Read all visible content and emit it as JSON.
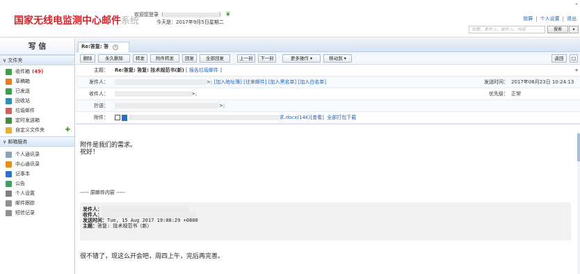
{
  "header": {
    "logo_main": "国家无线电监测中心邮件",
    "logo_sys": "系统",
    "welcome_line": "欢迎您登录（",
    "welcome_tail": "）",
    "date_line": "今天是：2017年9月5日星期二",
    "links": [
      "锁屏",
      "个人设置",
      "退出"
    ],
    "search_placeholder": "主题、发件人、收件人、内容",
    "search_button": "搜索",
    "search_dd": "▾",
    "collapse": "⌃"
  },
  "sidebar": {
    "compose": "写 信",
    "folders_title": "文件夹",
    "folders": [
      {
        "label": "收件箱",
        "count": "(49)",
        "icon": "inbox-icon",
        "color": "#3aa04a"
      },
      {
        "label": "草稿箱",
        "icon": "draft-icon",
        "color": "#e08020"
      },
      {
        "label": "已发送",
        "icon": "sent-icon",
        "color": "#3aa04a"
      },
      {
        "label": "回收站",
        "icon": "recycle-icon",
        "color": "#2a90c0"
      },
      {
        "label": "垃圾邮件",
        "icon": "spam-icon",
        "color": "#d06060"
      },
      {
        "label": "定时发送箱",
        "icon": "timer-icon",
        "color": "#4a8a3a"
      },
      {
        "label": "自定义文件夹",
        "icon": "folder-icon",
        "color": "#e8b030"
      }
    ],
    "services_title": "邮箱服务",
    "services": [
      {
        "label": "个人通讯录",
        "icon": "contacts-icon",
        "color": "#8aa0b8"
      },
      {
        "label": "中心通讯录",
        "icon": "org-contacts-icon",
        "color": "#e09020"
      },
      {
        "label": "记事本",
        "icon": "notepad-icon",
        "color": "#3070c0"
      },
      {
        "label": "公告",
        "icon": "notice-icon",
        "color": "#40a060"
      },
      {
        "label": "个人设置",
        "icon": "settings-icon",
        "color": "#808080"
      },
      {
        "label": "邮件跟踪",
        "icon": "track-icon",
        "color": "#909090"
      },
      {
        "label": "短信记录",
        "icon": "sms-icon",
        "color": "#909090"
      }
    ]
  },
  "tab": {
    "label": "Re:答复: 答",
    "close": "×"
  },
  "toolbar": {
    "buttons": [
      "删除",
      "永久删除",
      "转发",
      "附件转发",
      "回复",
      "全部回复",
      "上一封",
      "下一封",
      "更多操作 ▾",
      "移动到 ▾"
    ],
    "back": "返回",
    "extra": "□"
  },
  "fields": {
    "subject_label": "主题：",
    "subject": "Re:答复: 答复: 技术规范书(新)",
    "report_spam": "[ 报告垃圾邮件 ]",
    "from_label": "发件人：",
    "from_actions": "[加入地址簿] [往来邮件] [加入黑名单] [加入白名单]",
    "sent_time_label": "发送时间：",
    "sent_time": "2017年08月23日 10:24:13",
    "to_label": "收件人：",
    "priority_label": "优先级：",
    "priority": "正常",
    "cc_label": "抄送：",
    "attach_label": "附件：",
    "attach_name": "求.docx(14K)",
    "attach_view": "[查看]",
    "attach_all": "全部打包下载",
    "expand_icon": "+"
  },
  "message": {
    "line1": "附件是我们的需求。",
    "line2": "祝好！",
    "divider": "----- 原邮件内容 -----",
    "q_from_label": "发件人：",
    "q_to_label": "收件人：",
    "q_time_label": "发送时间：",
    "q_time": "Tue, 15 Aug 2017 19:08:29 +0800",
    "q_subject_label": "主题：",
    "q_subject": "答复: 技术规范书（新）",
    "reply": "很不错了，现这么开会吧，周四上午，完后再完善。"
  }
}
